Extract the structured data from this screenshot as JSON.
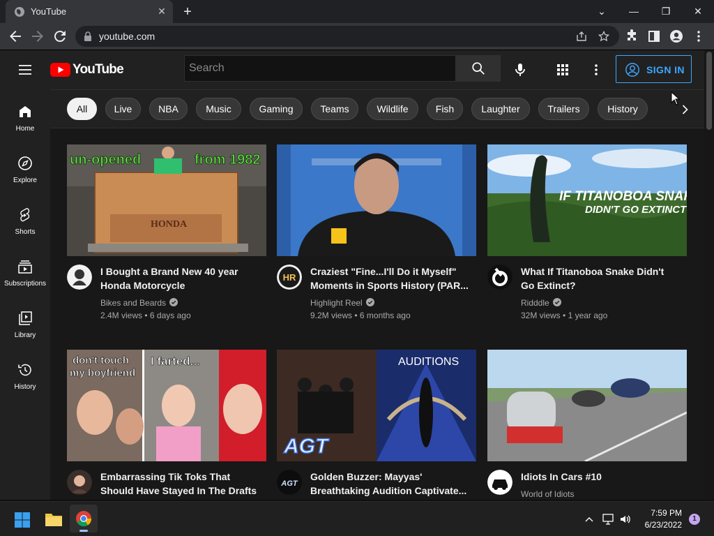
{
  "browser": {
    "tab_title": "YouTube",
    "url": "youtube.com"
  },
  "youtube": {
    "logo_text": "YouTube",
    "search_placeholder": "Search",
    "sign_in_label": "SIGN IN"
  },
  "guide": [
    {
      "label": "Home",
      "icon": "home-icon"
    },
    {
      "label": "Explore",
      "icon": "compass-icon"
    },
    {
      "label": "Shorts",
      "icon": "shorts-icon"
    },
    {
      "label": "Subscriptions",
      "icon": "subscriptions-icon"
    },
    {
      "label": "Library",
      "icon": "library-icon"
    },
    {
      "label": "History",
      "icon": "history-icon"
    }
  ],
  "chips": [
    "All",
    "Live",
    "NBA",
    "Music",
    "Gaming",
    "Teams",
    "Wildlife",
    "Fish",
    "Laughter",
    "Trailers",
    "History"
  ],
  "videos": [
    {
      "title": "I Bought a Brand New 40 year Honda Motorcycle",
      "channel": "Bikes and Beards",
      "verified": true,
      "views": "2.4M views",
      "age": "6 days ago",
      "thumb_text_1": "un-opened",
      "thumb_text_2": "from 1982",
      "thumb_text_3": "HONDA"
    },
    {
      "title": "Craziest \"Fine...I'll Do it Myself\" Moments in Sports History (PAR...",
      "channel": "Highlight Reel",
      "verified": true,
      "views": "9.2M views",
      "age": "6 months ago",
      "avatar_text": "HR"
    },
    {
      "title": "What If Titanoboa Snake Didn't Go Extinct?",
      "channel": "Ridddle",
      "verified": true,
      "views": "32M views",
      "age": "1 year ago",
      "thumb_text_1": "IF TITANOBOA SNAKE",
      "thumb_text_2": "DIDN'T GO EXTINCT?"
    },
    {
      "title": "Embarrassing Tik Toks That Should Have Stayed In The Drafts",
      "channel": "",
      "verified": false,
      "views": "",
      "age": "",
      "thumb_text_1": "don't touch",
      "thumb_text_2": "my boyfriend",
      "thumb_text_3": "I farted..."
    },
    {
      "title": "Golden Buzzer: Mayyas' Breathtaking Audition Captivate...",
      "channel": "",
      "verified": false,
      "views": "",
      "age": "",
      "thumb_text_1": "AUDITIONS",
      "thumb_text_2": "AGT",
      "avatar_text": "AGT"
    },
    {
      "title": "Idiots In Cars #10",
      "channel": "World of Idiots",
      "verified": false,
      "views": "",
      "age": ""
    }
  ],
  "taskbar": {
    "time": "7:59 PM",
    "date": "6/23/2022",
    "notification_count": "1"
  },
  "colors": {
    "youtube_red": "#ff0000",
    "sign_in_blue": "#3ea6ff",
    "background": "#181818"
  }
}
